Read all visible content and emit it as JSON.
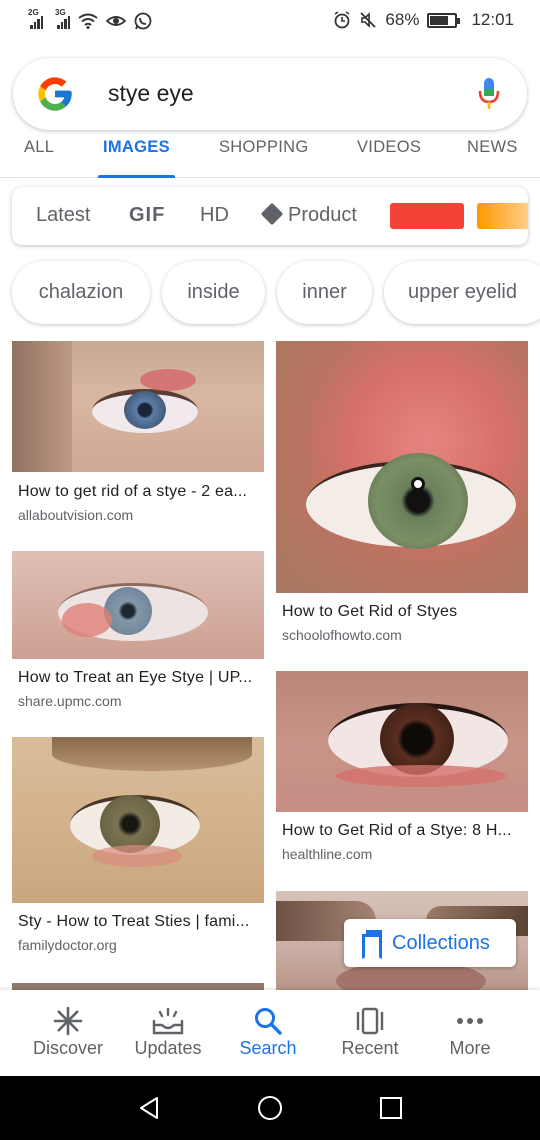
{
  "status_bar": {
    "signal_1": "2G",
    "signal_2": "3G",
    "battery_percent": "68%",
    "battery_level": 0.68,
    "time": "12:01",
    "icons": [
      "signal-icon",
      "signal-icon",
      "wifi-icon",
      "eye-icon",
      "whatsapp-icon",
      "alarm-icon",
      "mute-icon",
      "battery-icon"
    ]
  },
  "search": {
    "query": "stye eye",
    "logo": "google-logo",
    "mic_icon": "mic-icon"
  },
  "tabs": [
    {
      "label": "ALL",
      "active": false
    },
    {
      "label": "IMAGES",
      "active": true
    },
    {
      "label": "SHOPPING",
      "active": false
    },
    {
      "label": "VIDEOS",
      "active": false
    },
    {
      "label": "NEWS",
      "active": false
    }
  ],
  "filters": {
    "latest": "Latest",
    "gif": "GIF",
    "hd": "HD",
    "product": "Product",
    "color_swatches": [
      "#f44336",
      "#ff9800"
    ]
  },
  "chips": [
    "chalazion",
    "inside",
    "inner",
    "upper eyelid"
  ],
  "results": [
    {
      "title": "How to get rid of a stye - 2 ea...",
      "source": "allaboutvision.com"
    },
    {
      "title": "How to Get Rid of Styes",
      "source": "schoolofhowto.com"
    },
    {
      "title": "How to Treat an Eye Stye | UP...",
      "source": "share.upmc.com"
    },
    {
      "title": "How to Get Rid of a Stye: 8 H...",
      "source": "healthline.com"
    },
    {
      "title": "Sty - How to Treat Sties | fami...",
      "source": "familydoctor.org"
    }
  ],
  "collections_label": "Collections",
  "bottom_nav": [
    {
      "label": "Discover",
      "icon": "discover-icon",
      "active": false
    },
    {
      "label": "Updates",
      "icon": "updates-icon",
      "active": false
    },
    {
      "label": "Search",
      "icon": "search-icon",
      "active": true
    },
    {
      "label": "Recent",
      "icon": "recent-icon",
      "active": false
    },
    {
      "label": "More",
      "icon": "more-icon",
      "active": false
    }
  ],
  "colors": {
    "accent": "#1a73e8",
    "text": "#202124",
    "secondary_text": "#5f6368"
  }
}
